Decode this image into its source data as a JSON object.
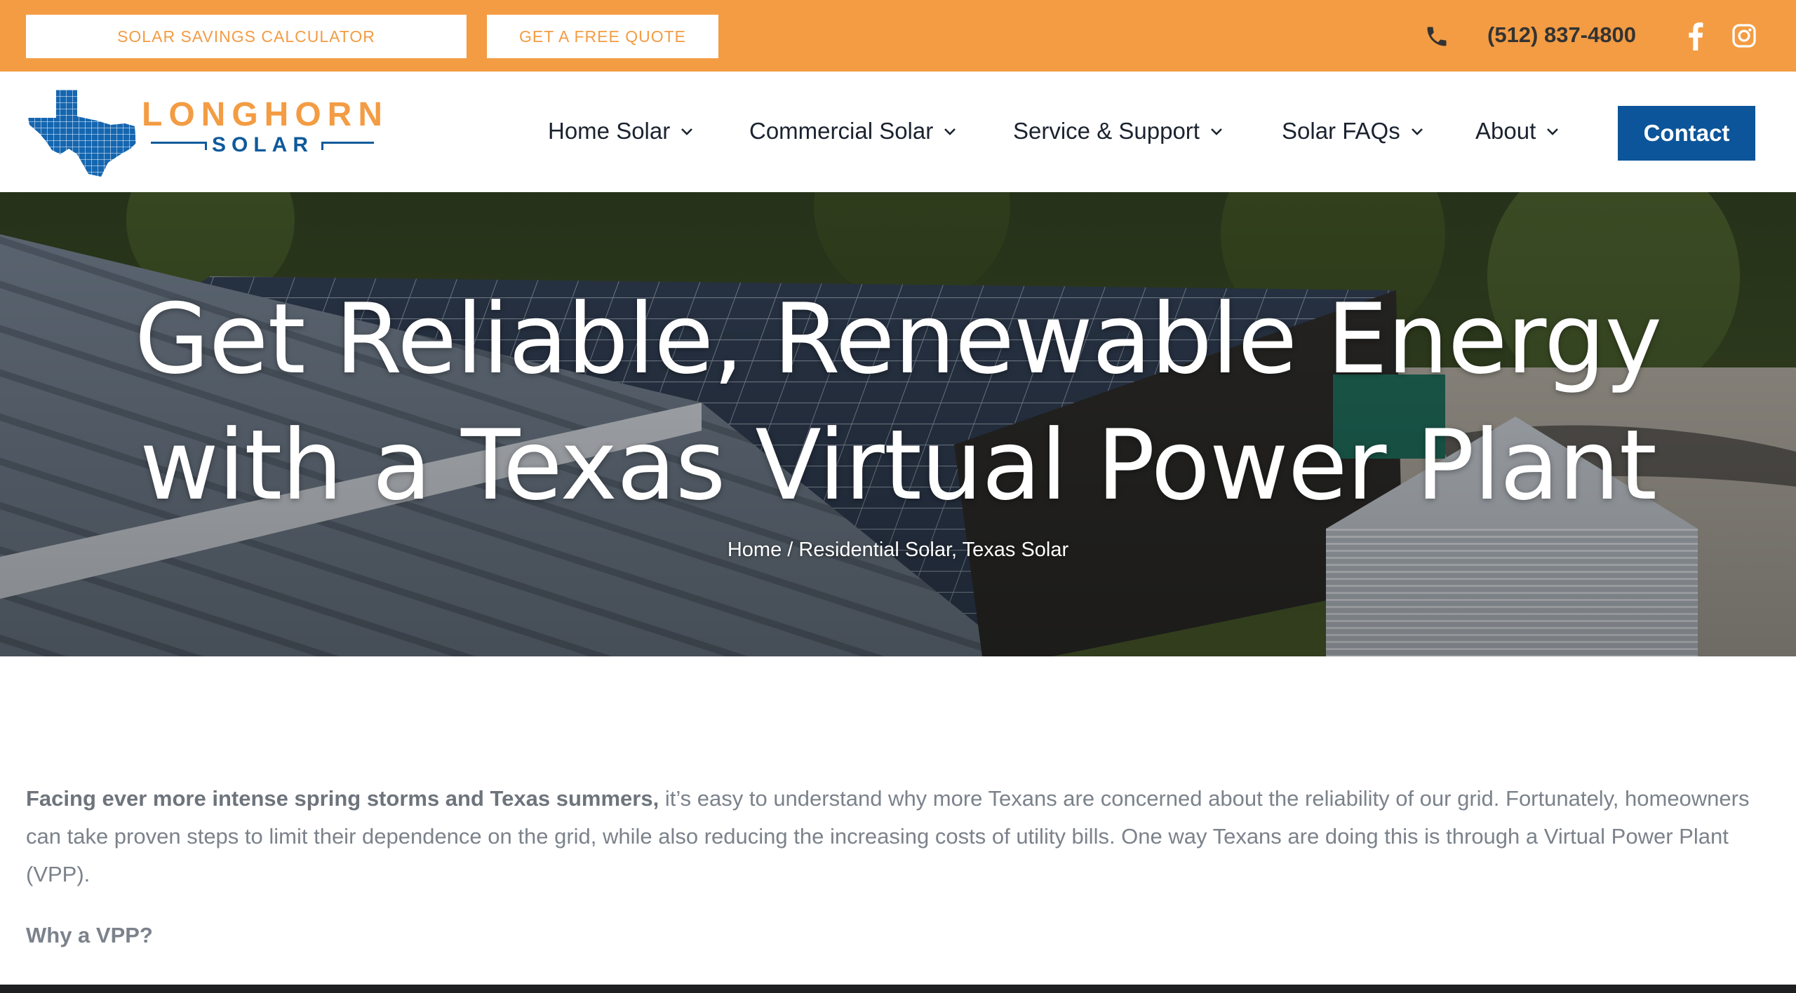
{
  "topbar": {
    "calculator_label": "SOLAR SAVINGS CALCULATOR",
    "quote_label": "GET A FREE QUOTE",
    "phone": "(512) 837-4800",
    "icons": [
      "phone-icon",
      "facebook-icon",
      "instagram-icon"
    ],
    "bg_color": "#f39c43"
  },
  "logo": {
    "word1": "LONGHORN",
    "word2": "SOLAR"
  },
  "nav": {
    "items": [
      {
        "label": "Home Solar"
      },
      {
        "label": "Commercial Solar"
      },
      {
        "label": "Service & Support"
      },
      {
        "label": "Solar FAQs"
      },
      {
        "label": "About"
      }
    ],
    "contact_label": "Contact",
    "contact_color": "#0c559a"
  },
  "hero": {
    "title_line1": "Get Reliable, Renewable Energy",
    "title_line2": "with a Texas Virtual Power Plant",
    "breadcrumb": {
      "home": "Home",
      "separator": " / ",
      "category1": "Residential Solar",
      "comma": ", ",
      "category2": "Texas Solar"
    }
  },
  "content": {
    "intro_bold": "Facing ever more intense spring storms and Texas summers,",
    "intro_rest": " it’s easy to understand why more Texans are concerned about the reliability of our grid. Fortunately, homeowners can take proven steps to limit their dependence on the grid, while also reducing the increasing costs of utility bills. One way Texans are doing this is through a Virtual Power Plant (VPP).",
    "subhead": "Why a VPP?"
  }
}
